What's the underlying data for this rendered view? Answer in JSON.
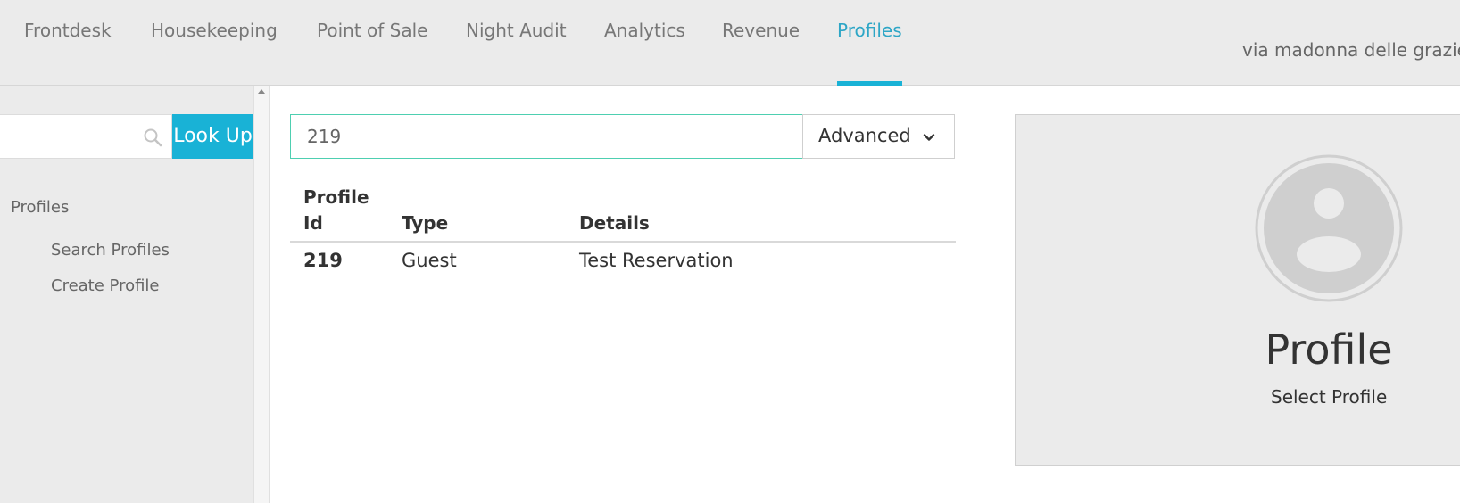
{
  "nav": {
    "tabs": [
      {
        "label": "Frontdesk"
      },
      {
        "label": "Housekeeping"
      },
      {
        "label": "Point of Sale"
      },
      {
        "label": "Night Audit"
      },
      {
        "label": "Analytics"
      },
      {
        "label": "Revenue"
      },
      {
        "label": "Profiles",
        "active": true
      }
    ],
    "hotel_name": "via madonna delle grazie"
  },
  "sidebar": {
    "search_value": "",
    "lookup_label": "Look Up",
    "section": "Profiles",
    "links": [
      {
        "label": "Search Profiles"
      },
      {
        "label": "Create Profile"
      }
    ]
  },
  "search": {
    "value": "219",
    "advanced_label": "Advanced"
  },
  "results": {
    "headers": {
      "id_line1": "Profile",
      "id_line2": "Id",
      "type": "Type",
      "details": "Details"
    },
    "rows": [
      {
        "id": "219",
        "type": "Guest",
        "details": "Test Reservation"
      }
    ]
  },
  "profile_card": {
    "title": "Profile",
    "subtitle": "Select Profile"
  },
  "colors": {
    "accent": "#19b2d6",
    "active_tab_text": "#2ea6c6",
    "search_border": "#4ecfb1",
    "nav_bg": "#ebebeb"
  }
}
